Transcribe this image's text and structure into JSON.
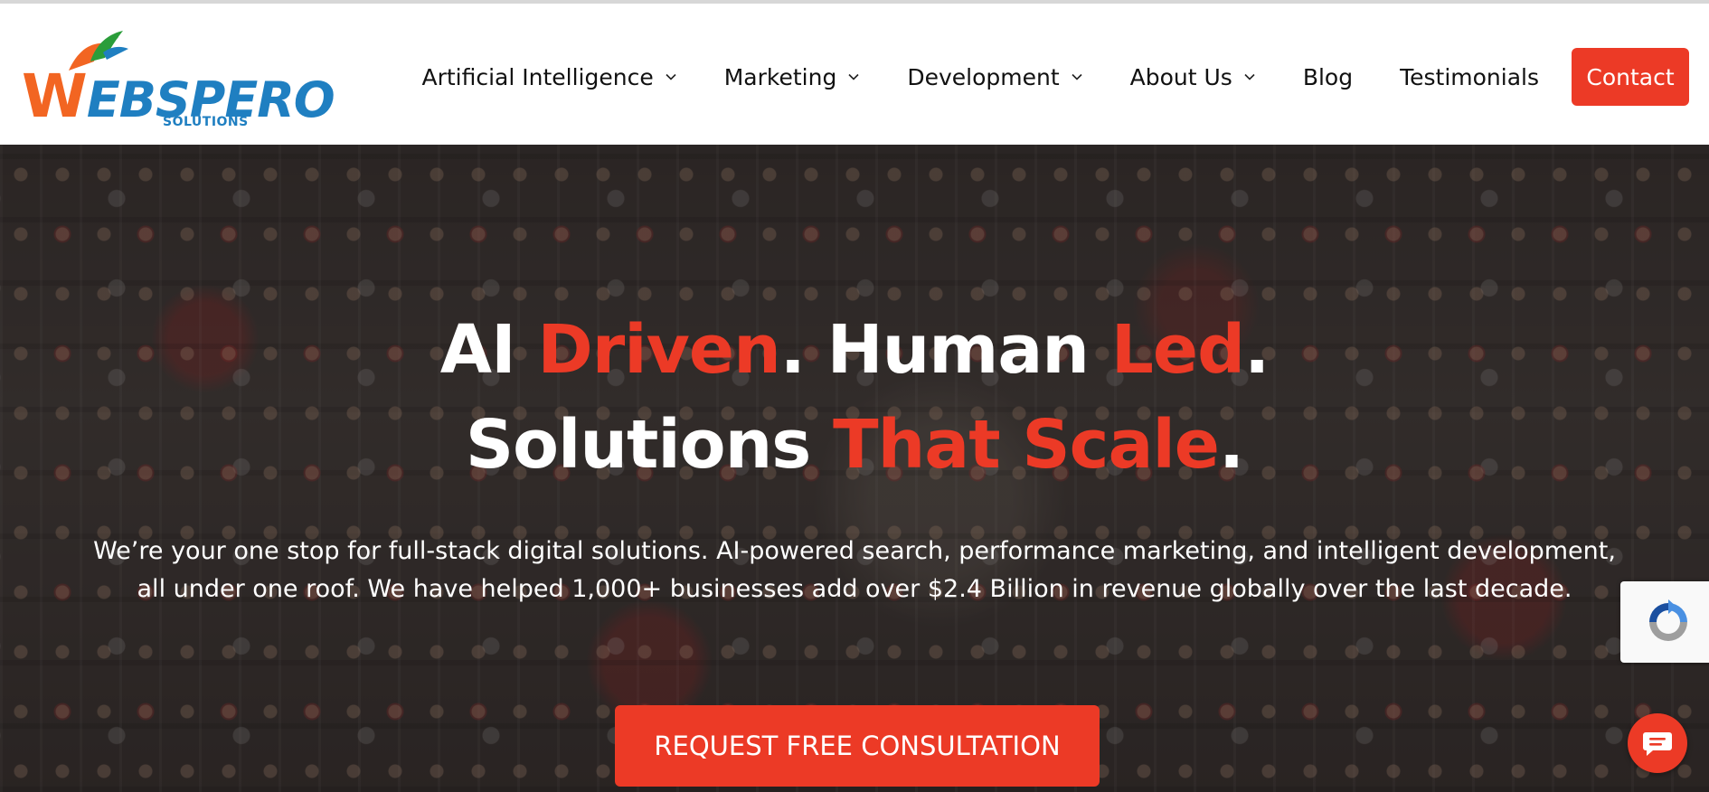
{
  "header": {
    "logo": {
      "wordmark_first": "W",
      "wordmark_rest": "EBSPERO",
      "subtitle": "SOLUTIONS"
    },
    "nav": [
      {
        "label": "Artificial Intelligence",
        "has_dropdown": true
      },
      {
        "label": "Marketing",
        "has_dropdown": true
      },
      {
        "label": "Development",
        "has_dropdown": true
      },
      {
        "label": "About Us",
        "has_dropdown": true
      },
      {
        "label": "Blog",
        "has_dropdown": false
      },
      {
        "label": "Testimonials",
        "has_dropdown": false
      }
    ],
    "contact_label": "Contact"
  },
  "hero": {
    "line1": {
      "a": "AI ",
      "b": "Driven",
      "c": ". Human ",
      "d": "Led",
      "e": "."
    },
    "line2": {
      "a": "Solutions ",
      "b": "That Scale",
      "c": "."
    },
    "description_line1": "We’re your one stop for full-stack digital solutions. AI-powered search, performance marketing, and intelligent development,",
    "description_line2": "all under one roof. We have helped 1,000+ businesses add over $2.4 Billion in revenue globally over the last decade.",
    "cta_label": "REQUEST FREE CONSULTATION"
  },
  "widgets": {
    "recaptcha_icon": "recaptcha-icon",
    "chat_icon": "chat-icon"
  },
  "colors": {
    "accent": "#ec3a26",
    "logo_orange": "#f26522",
    "logo_blue": "#1f7fc1",
    "text_dark": "#111111",
    "white": "#ffffff"
  }
}
